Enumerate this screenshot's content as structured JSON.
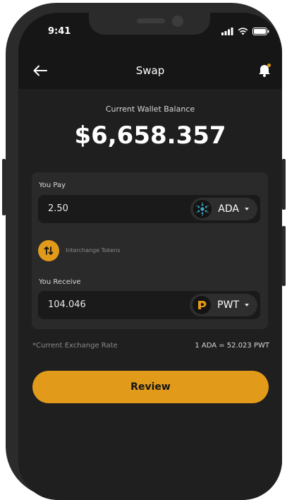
{
  "status_bar": {
    "time": "9:41"
  },
  "header": {
    "title": "Swap"
  },
  "balance": {
    "label": "Current Wallet Balance",
    "value": "$6,658.357"
  },
  "pay": {
    "label": "You Pay",
    "amount": "2.50",
    "token": "ADA",
    "token_icon": "cardano-icon"
  },
  "interchange": {
    "label": "Interchange Tokens"
  },
  "receive": {
    "label": "You Receive",
    "amount": "104.046",
    "token": "PWT",
    "token_icon": "pwt-logo-icon"
  },
  "exchange": {
    "label": "*Current Exchange Rate",
    "value": "1 ADA = 52.023 PWT"
  },
  "review_button": {
    "label": "Review"
  },
  "colors": {
    "accent": "#e19a1a",
    "background": "#1f1f1f",
    "card": "#2a2a2a",
    "frame": "#2b2b2b"
  }
}
